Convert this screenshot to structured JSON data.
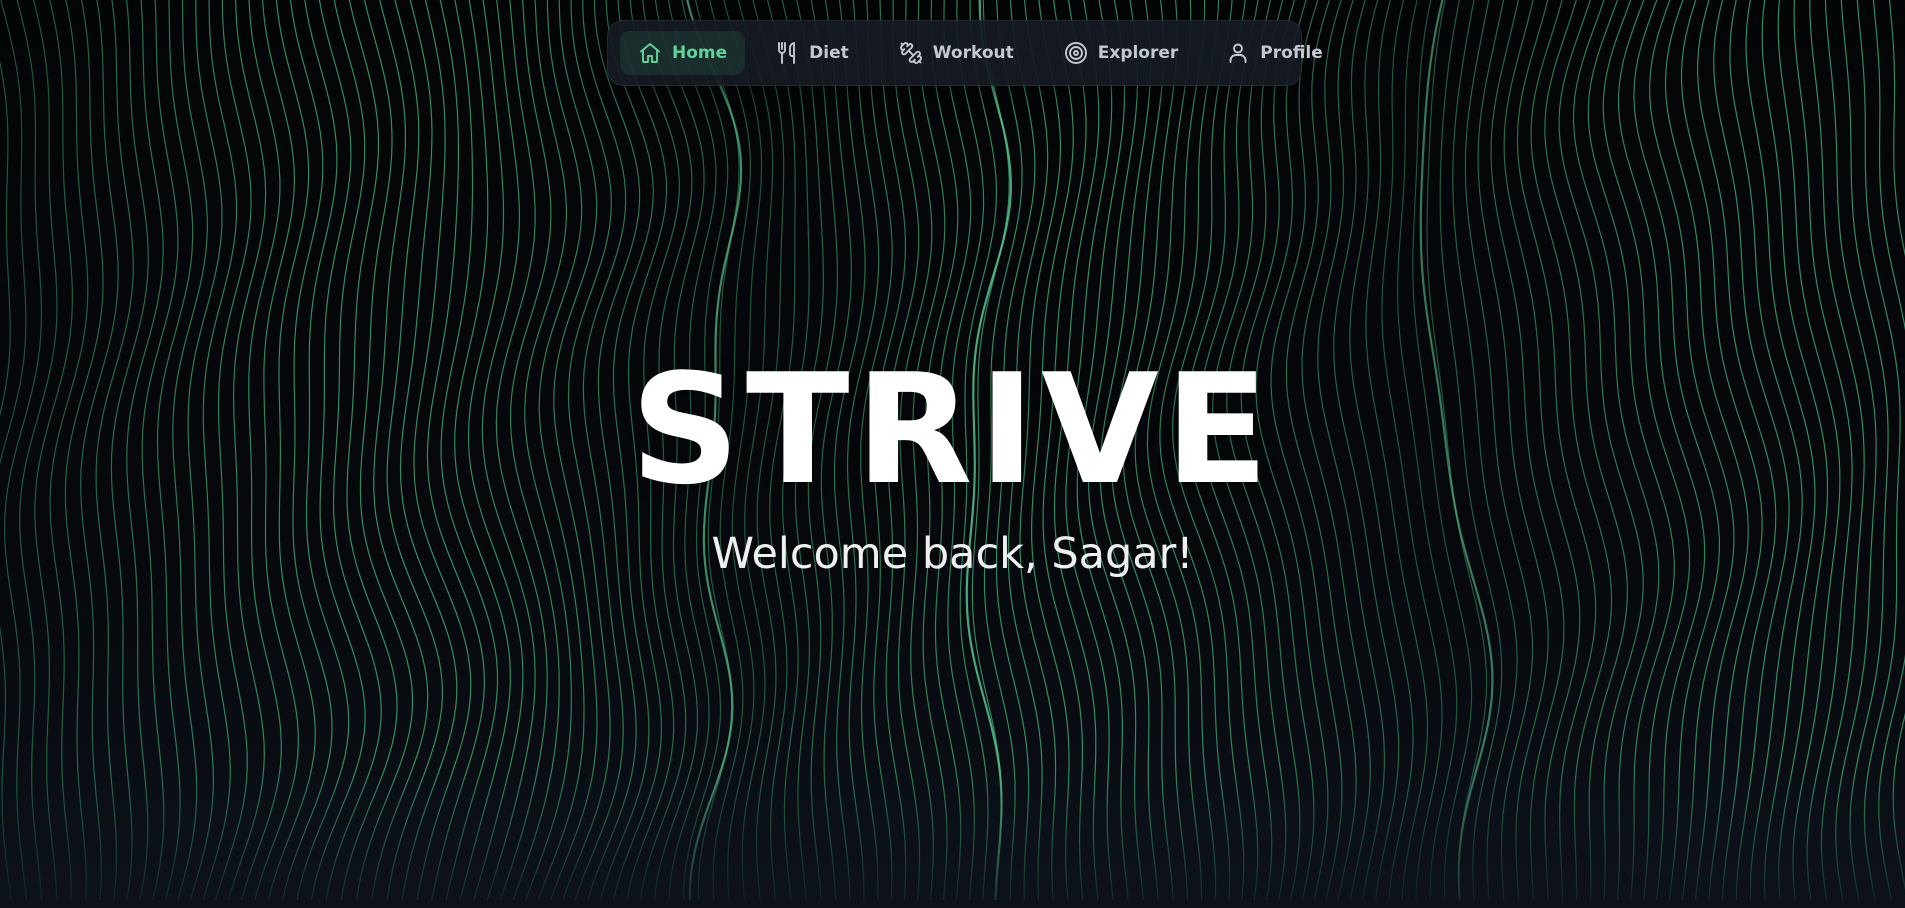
{
  "nav": {
    "items": [
      {
        "label": "Home",
        "icon": "home-icon",
        "active": true
      },
      {
        "label": "Diet",
        "icon": "utensils-icon",
        "active": false
      },
      {
        "label": "Workout",
        "icon": "dumbbell-icon",
        "active": false
      },
      {
        "label": "Explorer",
        "icon": "target-icon",
        "active": false
      },
      {
        "label": "Profile",
        "icon": "user-icon",
        "active": false
      }
    ]
  },
  "hero": {
    "title": "STRIVE",
    "subtitle": "Welcome back, Sagar!"
  },
  "colors": {
    "accent": "#5fd39a",
    "wave_line": "#3fae7c",
    "background": "#05070a",
    "nav_background": "#161b24"
  }
}
